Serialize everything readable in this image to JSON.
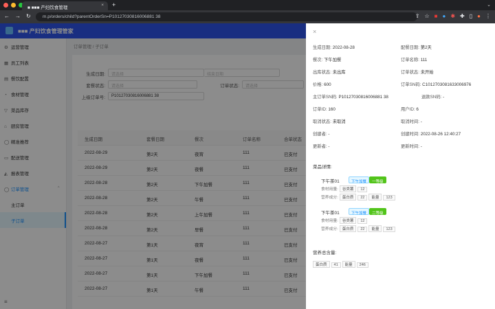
{
  "browser": {
    "tab_title": "■ ■■■ 产妇饮食管理",
    "url": "m.p/orders/child?parentOrderSn=P10127030816006881 38"
  },
  "app": {
    "title": "■■■ 产妇饮食管理管家"
  },
  "sidebar": {
    "items": [
      {
        "label": "运营管理",
        "icon": "⚙"
      },
      {
        "label": "员工列表",
        "icon": "▦"
      },
      {
        "label": "餐饮配置",
        "icon": "▤"
      },
      {
        "label": "食材管理",
        "icon": "◔"
      },
      {
        "label": "菜品库存",
        "icon": "▽"
      },
      {
        "label": "厨房管理",
        "icon": "⌂"
      },
      {
        "label": "精准推荐",
        "icon": "◯"
      },
      {
        "label": "配送管理",
        "icon": "▭"
      },
      {
        "label": "报表管理",
        "icon": "◭"
      },
      {
        "label": "订单管理",
        "icon": "◯"
      }
    ],
    "sub_items": [
      {
        "label": "主订单"
      },
      {
        "label": "子订单"
      }
    ]
  },
  "breadcrumb": "订单管理 / 子订单",
  "filters": {
    "date_label": "生成日期:",
    "date_placeholder": "请选择",
    "date_end_placeholder": "结束日期",
    "status_label": "套餐状态:",
    "status_placeholder": "请选择",
    "order_status_label": "订单状态:",
    "order_status_placeholder": "请选择",
    "parent_label": "上级订单号:",
    "parent_value": "P10127030816006881 38"
  },
  "table": {
    "headers": [
      "生成日期",
      "套餐日期",
      "餐次",
      "订单名称",
      "合单状态"
    ],
    "rows": [
      [
        "2022-08-29",
        "第2天",
        "夜宵",
        "111",
        "已支付"
      ],
      [
        "2022-08-29",
        "第2天",
        "夜餐",
        "111",
        "已支付"
      ],
      [
        "2022-08-28",
        "第2天",
        "下午加餐",
        "111",
        "已支付"
      ],
      [
        "2022-08-28",
        "第2天",
        "午餐",
        "111",
        "已支付"
      ],
      [
        "2022-08-28",
        "第2天",
        "上午加餐",
        "111",
        "已支付"
      ],
      [
        "2022-08-28",
        "第2天",
        "早餐",
        "111",
        "已支付"
      ],
      [
        "2022-08-27",
        "第1天",
        "夜宵",
        "111",
        "已支付"
      ],
      [
        "2022-08-27",
        "第1天",
        "夜餐",
        "111",
        "已支付"
      ],
      [
        "2022-08-27",
        "第1天",
        "下午加餐",
        "111",
        "已支付"
      ],
      [
        "2022-08-27",
        "第1天",
        "午餐",
        "111",
        "已支付"
      ]
    ]
  },
  "drawer": {
    "close_icon": "×",
    "fields": [
      [
        "生成日期:",
        "2022-08-28"
      ],
      [
        "配餐日期:",
        "第2天"
      ],
      [
        "餐次:",
        "下午加餐"
      ],
      [
        "订单名称:",
        "111"
      ],
      [
        "出库状态:",
        "未出库"
      ],
      [
        "订单状态:",
        "未开始"
      ],
      [
        "价格:",
        "600"
      ],
      [
        "订单SN码:",
        "C1012703081633006976"
      ],
      [
        "主订单SN码:",
        "P10127030816006881 38"
      ],
      [
        "退款SN码:",
        "-"
      ],
      [
        "订单ID:",
        "160"
      ],
      [
        "用户ID:",
        "6"
      ],
      [
        "取消状态:",
        "未取消"
      ],
      [
        "取消时间:",
        "-"
      ],
      [
        "创建者:",
        "-"
      ],
      [
        "创建时间:",
        "2022-08-26 12:40:27"
      ],
      [
        "更新者:",
        "-"
      ],
      [
        "更新时间:",
        "-"
      ]
    ],
    "meal_title": "菜品详情:",
    "meals": [
      {
        "name": "下午茶01",
        "tag1": "下午加餐",
        "tag2": "一等级",
        "amount_label": "食材用量:",
        "amount_chips": [
          "谷类薯",
          "12"
        ],
        "nutrition_label": "营养成分:",
        "nutrition_chips": [
          "蛋白质",
          "22",
          "能量",
          "123"
        ]
      },
      {
        "name": "下午茶01",
        "tag1": "下午加餐",
        "tag2": "二等级",
        "amount_label": "食材用量:",
        "amount_chips": [
          "谷类薯",
          "12"
        ],
        "nutrition_label": "营养成分:",
        "nutrition_chips": [
          "蛋白质",
          "22",
          "能量",
          "123"
        ]
      }
    ],
    "total_title": "营养总含量:",
    "total_chips": [
      "蛋白质",
      "41",
      "能量",
      "246"
    ]
  },
  "colors": {
    "header": "#2f54eb",
    "accent": "#1890ff",
    "tag_green": "#52c41a"
  }
}
